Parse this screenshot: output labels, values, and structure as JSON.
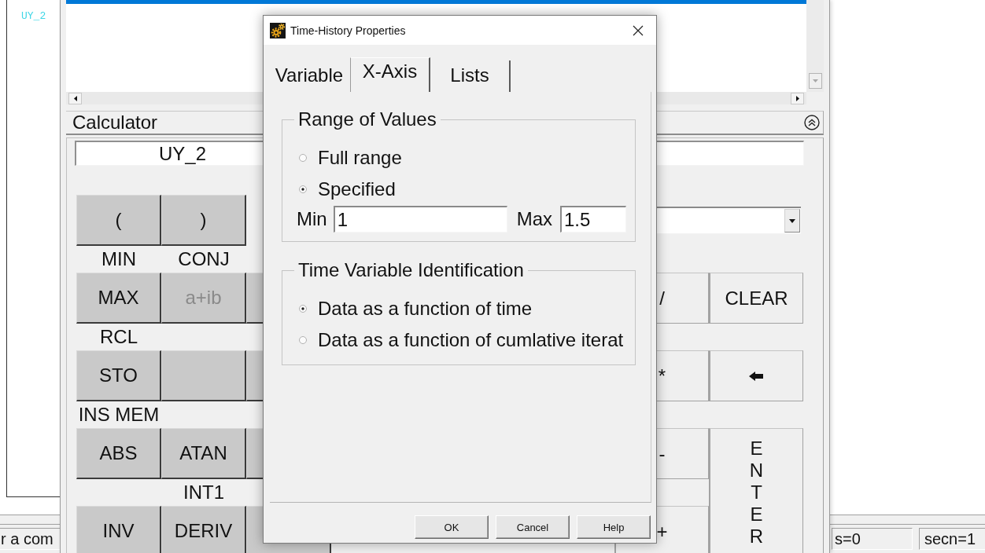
{
  "main_window": {
    "curve_label": "UY_2",
    "status_bar": {
      "fields": [
        "r a com",
        "s=0",
        "secn=1"
      ]
    }
  },
  "calculator_panel": {
    "list": {
      "rows": [
        {
          "selected": true
        }
      ]
    },
    "title": "Calculator",
    "expression": "UY_2",
    "keypad": [
      {
        "left": [
          {
            "kind": "key",
            "label": "(",
            "disabled": false
          },
          {
            "kind": "key",
            "label": ")",
            "disabled": false
          }
        ]
      },
      {
        "left": [
          {
            "kind": "key",
            "label": "MAX",
            "shift_label": "MIN",
            "disabled": false
          },
          {
            "kind": "key",
            "label": "a+ib",
            "shift_label": "CONJ",
            "disabled": true
          },
          {
            "kind": "blank"
          }
        ],
        "right": [
          {
            "kind": "key",
            "label": "/",
            "disabled": false
          },
          {
            "kind": "key",
            "label": "CLEAR",
            "disabled": false
          }
        ]
      },
      {
        "left": [
          {
            "kind": "key",
            "label": "STO",
            "shift_label": "RCL",
            "disabled": false
          },
          {
            "kind": "blank"
          },
          {
            "kind": "blank"
          }
        ],
        "right": [
          {
            "kind": "key",
            "label": "*",
            "disabled": false
          },
          {
            "kind": "icon",
            "disabled": false
          }
        ]
      },
      {
        "left": [
          {
            "kind": "key",
            "label": "ABS",
            "shift_label": "INS MEM",
            "disabled": false
          },
          {
            "kind": "key",
            "label": "ATAN",
            "disabled": false
          },
          {
            "kind": "blank"
          }
        ],
        "right": [
          {
            "kind": "key",
            "label": "-",
            "disabled": false
          },
          {
            "kind": "tall",
            "label": "ENTER",
            "disabled": false
          }
        ]
      },
      {
        "left": [
          {
            "kind": "key",
            "label": "INV",
            "disabled": false
          },
          {
            "kind": "key",
            "label": "DERIV",
            "shift_label": "INT1",
            "disabled": false
          },
          {
            "kind": "blank"
          }
        ],
        "right": [
          {
            "kind": "key",
            "label": "+",
            "disabled": false
          }
        ]
      }
    ]
  },
  "dialog": {
    "title": "Time-History Properties",
    "tabs": [
      {
        "label": "Variable",
        "selected": false
      },
      {
        "label": "X-Axis",
        "selected": true
      },
      {
        "label": "Lists",
        "selected": false
      }
    ],
    "groups": [
      {
        "title": "Range of Values",
        "options": [
          {
            "label": "Full range",
            "selected": false
          },
          {
            "label": "Specified",
            "selected": true
          }
        ],
        "fields": [
          {
            "label": "Min",
            "value": "1"
          },
          {
            "label": "Max",
            "value": "1.5"
          }
        ]
      },
      {
        "title": "Time Variable Identification",
        "options": [
          {
            "label": "Data as a function of time",
            "selected": true
          },
          {
            "label": "Data as a function of cumlative iterat",
            "selected": false
          }
        ]
      }
    ],
    "buttons": [
      "OK",
      "Cancel",
      "Help"
    ]
  }
}
